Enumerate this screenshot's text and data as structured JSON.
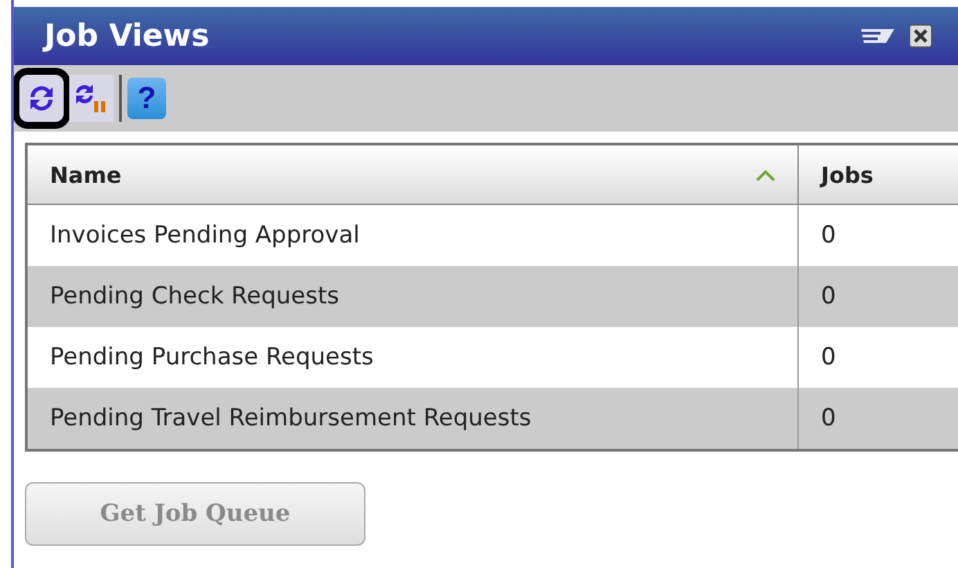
{
  "window": {
    "title": "Job Views"
  },
  "toolbar": [
    {
      "kind": "refresh",
      "highlighted": true
    },
    {
      "kind": "refresh-pause",
      "highlighted": false
    },
    {
      "kind": "separator"
    },
    {
      "kind": "help",
      "text": "?",
      "highlighted": false
    }
  ],
  "table": {
    "columns": [
      {
        "label": "Name",
        "sorted": true
      },
      {
        "label": "Jobs",
        "sorted": false
      }
    ],
    "rows": [
      {
        "name": "Invoices Pending Approval",
        "jobs": "0"
      },
      {
        "name": "Pending Check Requests",
        "jobs": "0"
      },
      {
        "name": "Pending Purchase Requests",
        "jobs": "0"
      },
      {
        "name": "Pending Travel Reimbursement Requests",
        "jobs": "0"
      }
    ]
  },
  "button": {
    "label": "Get Job Queue",
    "disabled": true
  }
}
